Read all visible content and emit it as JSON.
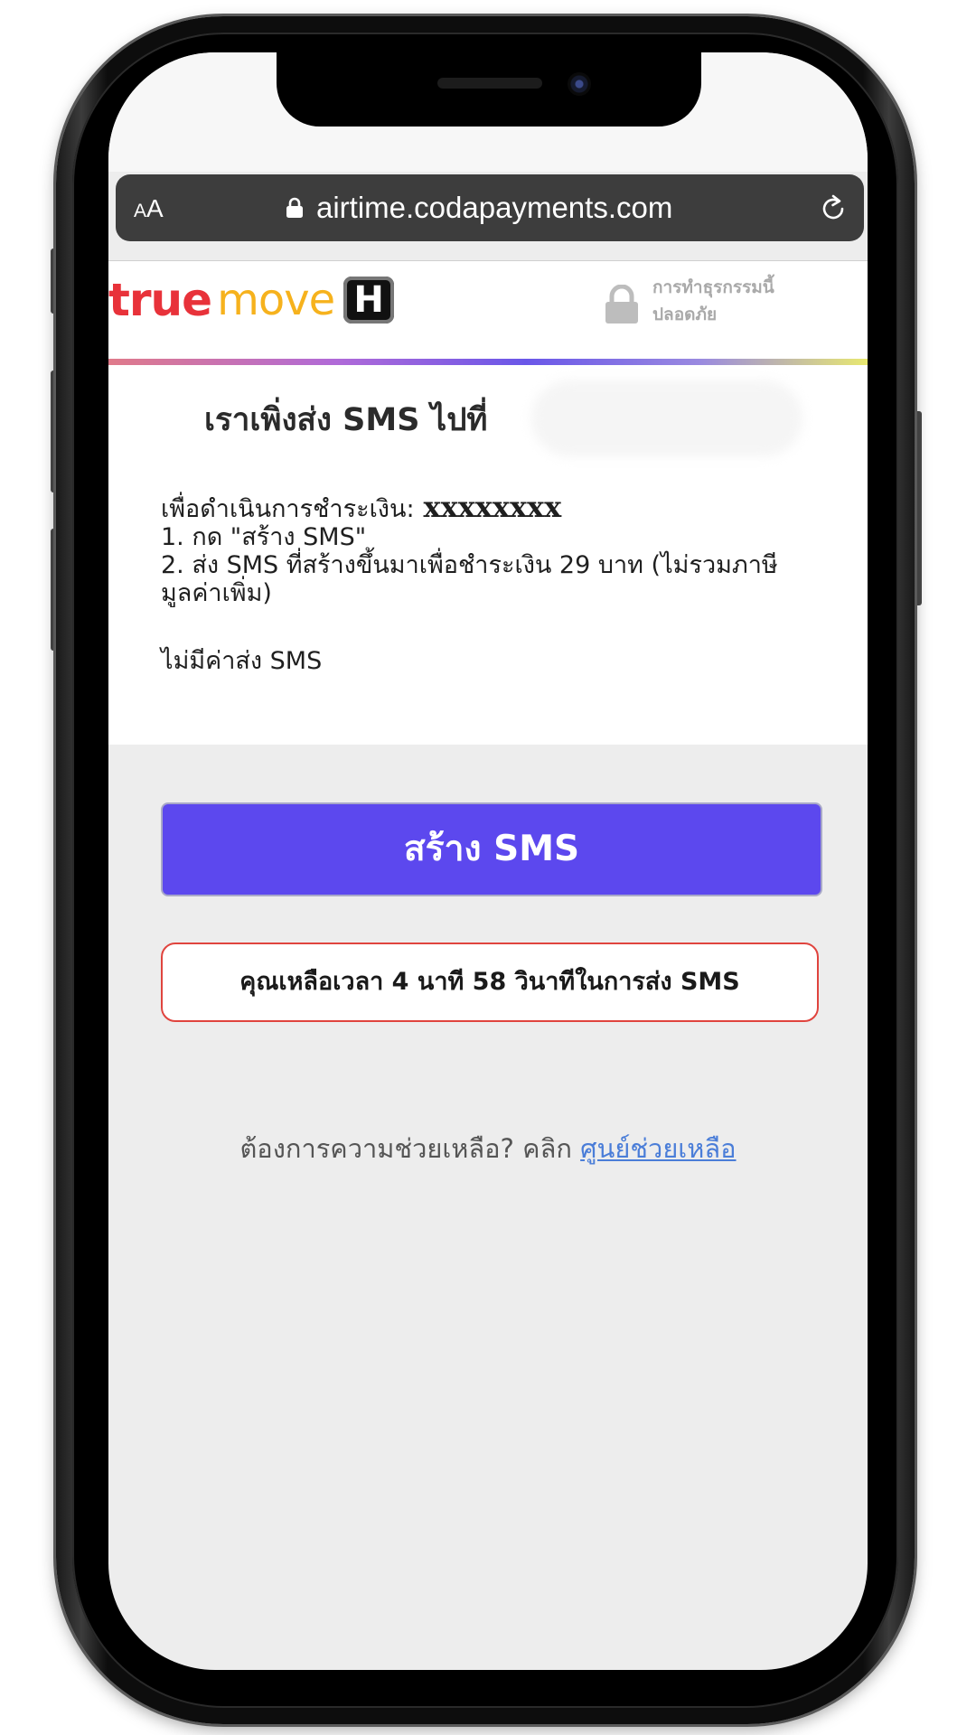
{
  "browser": {
    "aa_small": "A",
    "aa_large": "A",
    "url": "airtime.codapayments.com"
  },
  "header": {
    "logo": {
      "part1": "true",
      "part2": "move",
      "badge": "H"
    },
    "secure_line1": "การทำธุรกรรมนี้",
    "secure_line2": "ปลอดภัย"
  },
  "main": {
    "title": "เราเพิ่งส่ง SMS ไปที่",
    "payment_label": "เพื่อดำเนินการชำระเงิน:",
    "payment_code": "xxxxxxxx",
    "step1": "1. กด \"สร้าง SMS\"",
    "step2": "2. ส่ง SMS ที่สร้างขึ้นมาเพื่อชำระเงิน 29 บาท (ไม่รวมภาษี",
    "step2_cont": "มูลค่าเพิ่ม)",
    "no_fee": "ไม่มีค่าส่ง SMS",
    "create_button": "สร้าง SMS",
    "timer_text": "คุณเหลือเวลา 4 นาที 58 วินาทีในการส่ง SMS",
    "help_text": "ต้องการความช่วยเหลือ? คลิก",
    "help_link": "ศูนย์ช่วยเหลือ"
  },
  "colors": {
    "primary_button": "#5c48ee",
    "timer_border": "#e0443e",
    "link": "#4a7dd8",
    "logo_true": "#e8323a",
    "logo_move": "#f6b21d"
  },
  "icons": {
    "url_lock": "lock-icon",
    "reload": "reload-icon",
    "secure": "padlock-icon"
  }
}
